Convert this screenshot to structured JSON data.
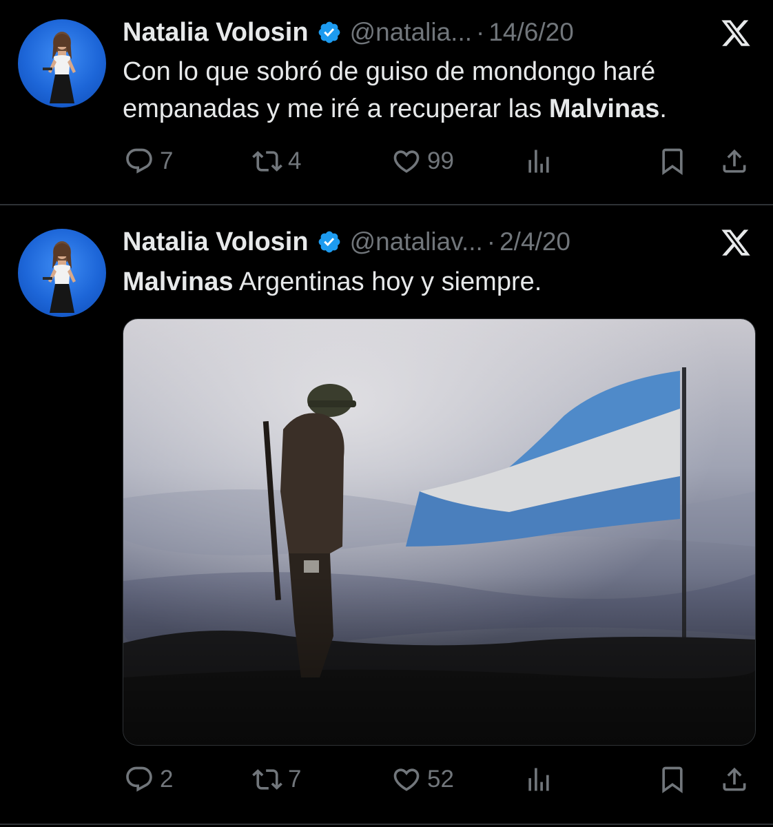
{
  "colors": {
    "background": "#000000",
    "text": "#e7e9ea",
    "muted": "#71767b",
    "verified": "#1d9bf0",
    "divider": "#2f3336"
  },
  "tweets": [
    {
      "author": "Natalia Volosin",
      "handle": "@natalia...",
      "separator": "·",
      "date": "14/6/20",
      "text_line1": "Con lo que sobró de guiso de mondongo haré",
      "text_line2_pre": "empanadas y me iré a recuperar las ",
      "text_line2_bold": "Malvinas",
      "text_line2_post": ".",
      "replies": "7",
      "reposts": "4",
      "likes": "99",
      "icons": [
        "verified-badge-icon",
        "x-logo-icon",
        "reply-icon",
        "repost-icon",
        "like-icon",
        "views-icon",
        "bookmark-icon",
        "share-icon"
      ]
    },
    {
      "author": "Natalia Volosin",
      "handle": "@nataliav...",
      "separator": "·",
      "date": "2/4/20",
      "text_bold": "Malvinas",
      "text_rest": " Argentinas hoy y siempre.",
      "replies": "2",
      "reposts": "7",
      "likes": "52",
      "icons": [
        "verified-badge-icon",
        "x-logo-icon",
        "reply-icon",
        "repost-icon",
        "like-icon",
        "views-icon",
        "bookmark-icon",
        "share-icon"
      ]
    }
  ]
}
